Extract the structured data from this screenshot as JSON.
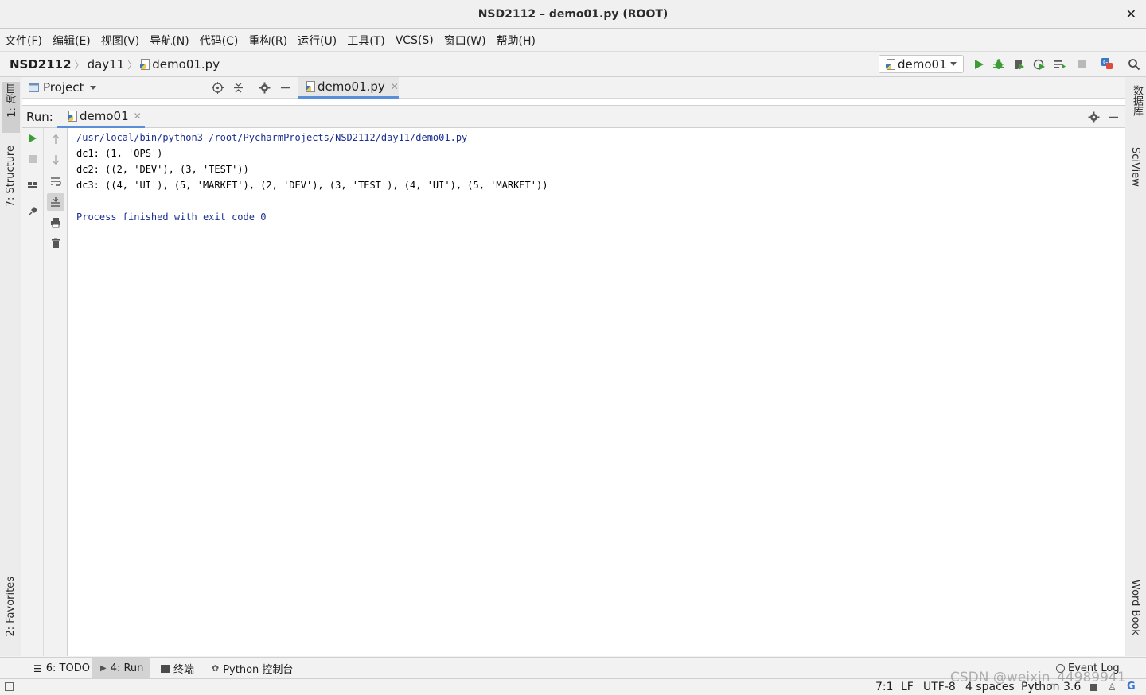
{
  "window": {
    "title": "NSD2112 – demo01.py (ROOT)",
    "close_glyph": "✕"
  },
  "menu": [
    "文件(F)",
    "编辑(E)",
    "视图(V)",
    "导航(N)",
    "代码(C)",
    "重构(R)",
    "运行(U)",
    "工具(T)",
    "VCS(S)",
    "窗口(W)",
    "帮助(H)"
  ],
  "breadcrumb": {
    "project": "NSD2112",
    "folder": "day11",
    "file": "demo01.py"
  },
  "run_config": {
    "selected": "demo01"
  },
  "left_tool_tabs": {
    "project": "1: 项目",
    "structure": "7: Structure",
    "favorites": "2: Favorites"
  },
  "right_tool_tabs": {
    "database": "数据库",
    "sciview": "SciView",
    "wordbook": "Word Book"
  },
  "project_panel": {
    "title": "Project"
  },
  "editor_tab": {
    "label": "demo01.py"
  },
  "run_panel": {
    "label": "Run:",
    "tab": "demo01"
  },
  "console": {
    "command": "/usr/local/bin/python3 /root/PycharmProjects/NSD2112/day11/demo01.py",
    "lines": [
      "dc1: (1, 'OPS')",
      "dc2: ((2, 'DEV'), (3, 'TEST'))",
      "dc3: ((4, 'UI'), (5, 'MARKET'), (2, 'DEV'), (3, 'TEST'), (4, 'UI'), (5, 'MARKET'))"
    ],
    "exit": "Process finished with exit code 0"
  },
  "bottom_tabs": {
    "todo": "6: TODO",
    "run": "4: Run",
    "terminal": "终端",
    "python_console": "Python 控制台",
    "event_log": "Event Log"
  },
  "status": {
    "position": "7:1",
    "line_sep": "LF",
    "encoding": "UTF-8",
    "indent": "4 spaces",
    "interpreter": "Python 3.6"
  },
  "watermark": "CSDN @weixin_44989941",
  "colors": {
    "run_green": "#3e9c35",
    "accent_blue": "#5a8fd8",
    "console_blue": "#1c2f91"
  }
}
